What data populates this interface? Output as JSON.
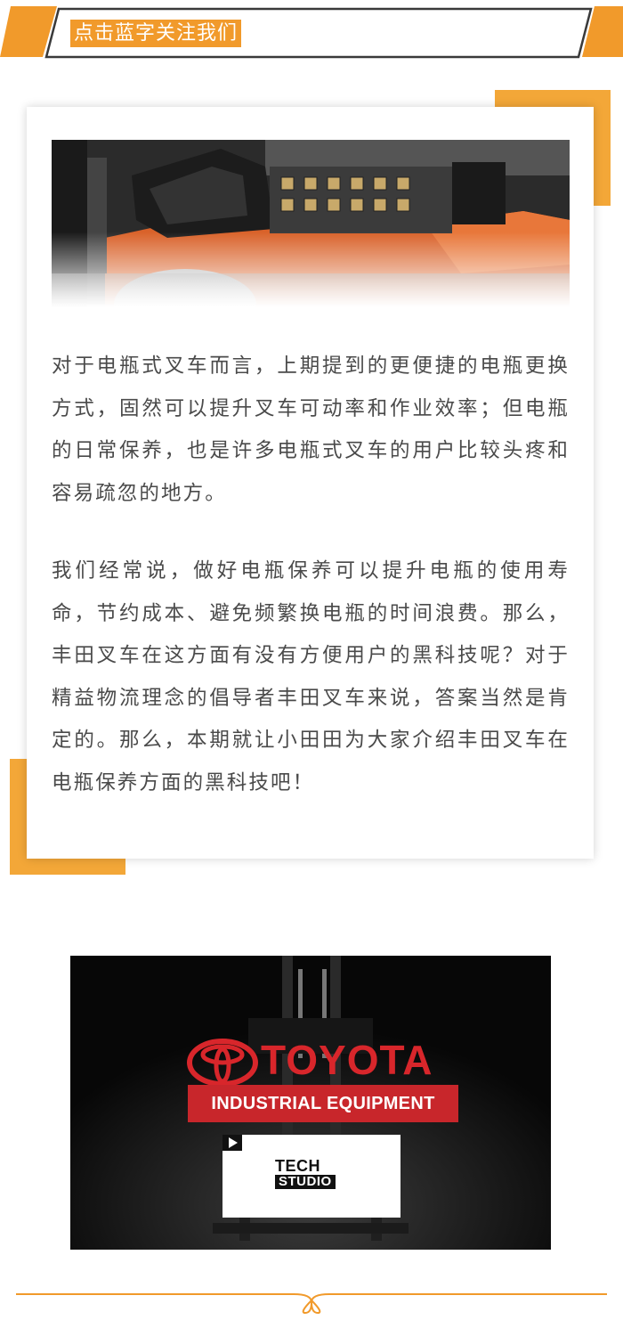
{
  "header": {
    "follow_label": "点击蓝字关注我们"
  },
  "article": {
    "paragraph_1": "对于电瓶式叉车而言，上期提到的更便捷的电瓶更换方式，固然可以提升叉车可动率和作业效率；但电瓶的日常保养，也是许多电瓶式叉车的用户比较头疼和容易疏忽的地方。",
    "paragraph_2": "我们经常说，做好电瓶保养可以提升电瓶的使用寿命，节约成本、避免频繁换电瓶的时间浪费。那么，丰田叉车在这方面有没有方便用户的黑科技呢？对于精益物流理念的倡导者丰田叉车来说，答案当然是肯定的。那么，本期就让小田田为大家介绍丰田叉车在电瓶保养方面的黑科技吧！"
  },
  "video": {
    "brand": "TOYOTA",
    "division": "INDUSTRIAL EQUIPMENT",
    "tech_line1": "TECH",
    "tech_line2": "STUDIO"
  },
  "colors": {
    "accent_orange": "#f19a2b",
    "toyota_red": "#d8262b",
    "text_gray": "#4a4a4a"
  },
  "icons": {
    "photo": "forklift-battery-photo",
    "logo": "toyota-emblem-icon",
    "play": "play-icon",
    "divider_ornament": "loop-ornament-icon"
  }
}
